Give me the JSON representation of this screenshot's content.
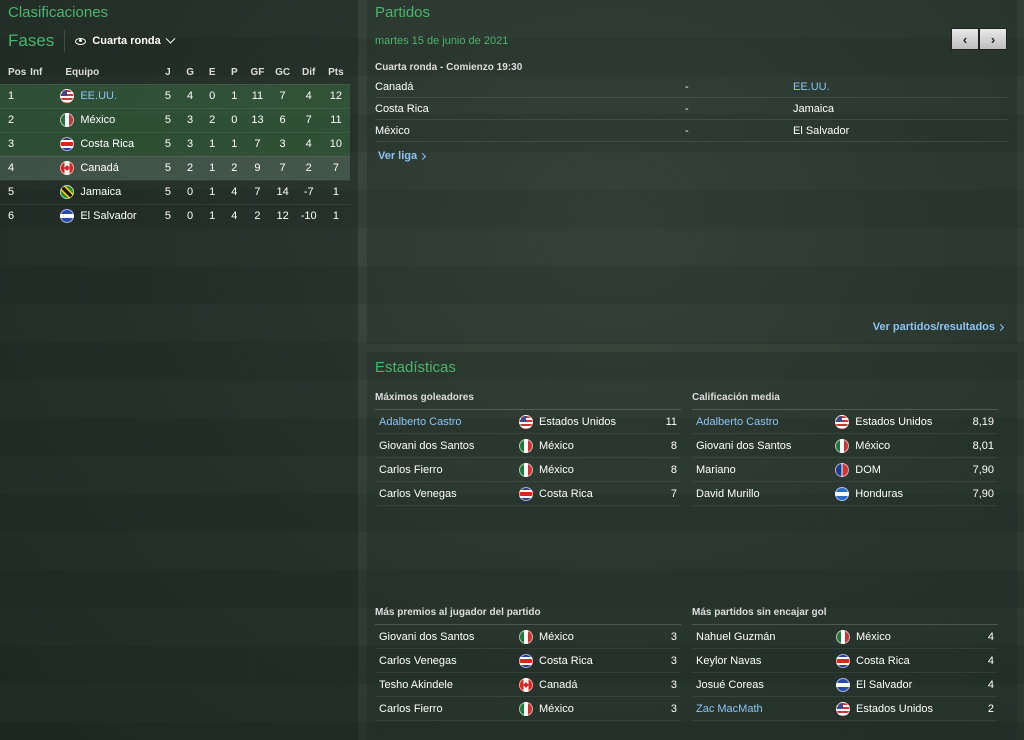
{
  "clasificaciones": {
    "title": "Clasificaciones",
    "fases_label": "Fases",
    "round_dropdown": "Cuarta ronda",
    "columns": [
      "Pos",
      "Inf",
      "Equipo",
      "J",
      "G",
      "E",
      "P",
      "GF",
      "GC",
      "Dif",
      "Pts"
    ],
    "rows": [
      {
        "pos": "1",
        "inf": "",
        "team": "EE.UU.",
        "flag": "usa-flag-icon",
        "j": "5",
        "g": "4",
        "e": "0",
        "p": "1",
        "gf": "11",
        "gc": "7",
        "dif": "4",
        "pts": "12"
      },
      {
        "pos": "2",
        "inf": "",
        "team": "México",
        "flag": "mexico-flag-icon",
        "j": "5",
        "g": "3",
        "e": "2",
        "p": "0",
        "gf": "13",
        "gc": "6",
        "dif": "7",
        "pts": "11"
      },
      {
        "pos": "3",
        "inf": "",
        "team": "Costa Rica",
        "flag": "costa-rica-flag-icon",
        "j": "5",
        "g": "3",
        "e": "1",
        "p": "1",
        "gf": "7",
        "gc": "3",
        "dif": "4",
        "pts": "10"
      },
      {
        "pos": "4",
        "inf": "",
        "team": "Canadá",
        "flag": "canada-flag-icon",
        "j": "5",
        "g": "2",
        "e": "1",
        "p": "2",
        "gf": "9",
        "gc": "7",
        "dif": "2",
        "pts": "7"
      },
      {
        "pos": "5",
        "inf": "",
        "team": "Jamaica",
        "flag": "jamaica-flag-icon",
        "j": "5",
        "g": "0",
        "e": "1",
        "p": "4",
        "gf": "7",
        "gc": "14",
        "dif": "-7",
        "pts": "1"
      },
      {
        "pos": "6",
        "inf": "",
        "team": "El Salvador",
        "flag": "el-salvador-flag-icon",
        "j": "5",
        "g": "0",
        "e": "1",
        "p": "4",
        "gf": "2",
        "gc": "12",
        "dif": "-10",
        "pts": "1"
      }
    ]
  },
  "partidos": {
    "title": "Partidos",
    "date": "martes 15 de junio de 2021",
    "round": "Cuarta ronda - Comienzo 19:30",
    "matches": [
      {
        "home": "Canadá",
        "sep": "-",
        "away": "EE.UU."
      },
      {
        "home": "Costa Rica",
        "sep": "-",
        "away": "Jamaica"
      },
      {
        "home": "México",
        "sep": "-",
        "away": "El Salvador"
      }
    ],
    "ver_liga": "Ver liga",
    "ver_partidos": "Ver partidos/resultados",
    "prev": "‹",
    "next": "›"
  },
  "estadisticas": {
    "title": "Estadísticas",
    "goleadores": {
      "title": "Máximos goleadores",
      "rows": [
        {
          "name": "Adalberto Castro",
          "team": "Estados Unidos",
          "value": "11"
        },
        {
          "name": "Giovani dos Santos",
          "team": "México",
          "value": "8"
        },
        {
          "name": "Carlos Fierro",
          "team": "México",
          "value": "8"
        },
        {
          "name": "Carlos Venegas",
          "team": "Costa Rica",
          "value": "7"
        }
      ]
    },
    "calificacion": {
      "title": "Calificación media",
      "rows": [
        {
          "name": "Adalberto Castro",
          "team": "Estados Unidos",
          "value": "8,19"
        },
        {
          "name": "Giovani dos Santos",
          "team": "México",
          "value": "8,01"
        },
        {
          "name": "Mariano",
          "team": "DOM",
          "value": "7,90"
        },
        {
          "name": "David Murillo",
          "team": "Honduras",
          "value": "7,90"
        }
      ]
    },
    "premios": {
      "title": "Más premios al jugador del partido",
      "rows": [
        {
          "name": "Giovani dos Santos",
          "team": "México",
          "value": "3"
        },
        {
          "name": "Carlos Venegas",
          "team": "Costa Rica",
          "value": "3"
        },
        {
          "name": "Tesho Akindele",
          "team": "Canadá",
          "value": "3"
        },
        {
          "name": "Carlos Fierro",
          "team": "México",
          "value": "3"
        }
      ]
    },
    "imbatidos": {
      "title": "Más partidos sin encajar gol",
      "rows": [
        {
          "name": "Nahuel Guzmán",
          "team": "México",
          "value": "4"
        },
        {
          "name": "Keylor Navas",
          "team": "Costa Rica",
          "value": "4"
        },
        {
          "name": "Josué Coreas",
          "team": "El Salvador",
          "value": "4"
        },
        {
          "name": "Zac MacMath",
          "team": "Estados Unidos",
          "value": "2"
        }
      ]
    }
  },
  "colors": {
    "accent_green": "#4cb46c",
    "link_blue": "#8ec4f2",
    "promotion_row": "#468c50"
  }
}
